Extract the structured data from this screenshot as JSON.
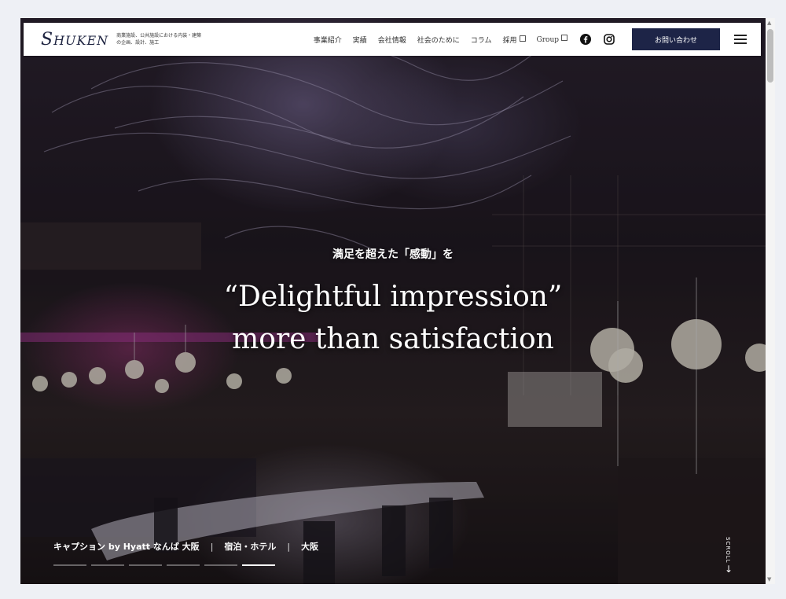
{
  "header": {
    "logo": "HUKEN",
    "logo_initial": "S",
    "tagline": "商業施設、公共施設における内装・建築の企画、設計、施工",
    "nav": [
      {
        "label": "事業紹介"
      },
      {
        "label": "実績"
      },
      {
        "label": "会社情報"
      },
      {
        "label": "社会のために"
      },
      {
        "label": "コラム"
      },
      {
        "label": "採用"
      },
      {
        "label": "Group"
      }
    ],
    "contact_label": "お問い合わせ",
    "social_icons": [
      "facebook-icon",
      "instagram-icon"
    ]
  },
  "hero": {
    "catch": "満足を超えた「感動」を",
    "headline_line1": "“Delightful impression”",
    "headline_line2": "more than satisfaction",
    "caption": {
      "project": "キャプション by Hyatt なんば 大阪",
      "category": "宿泊・ホテル",
      "location": "大阪",
      "separator": "|"
    },
    "slide_count": 6,
    "active_slide": 6,
    "scroll_label": "SCROLL"
  },
  "colors": {
    "accent": "#1d2447",
    "header_bg": "#ffffff",
    "hero_text": "#ffffff"
  }
}
